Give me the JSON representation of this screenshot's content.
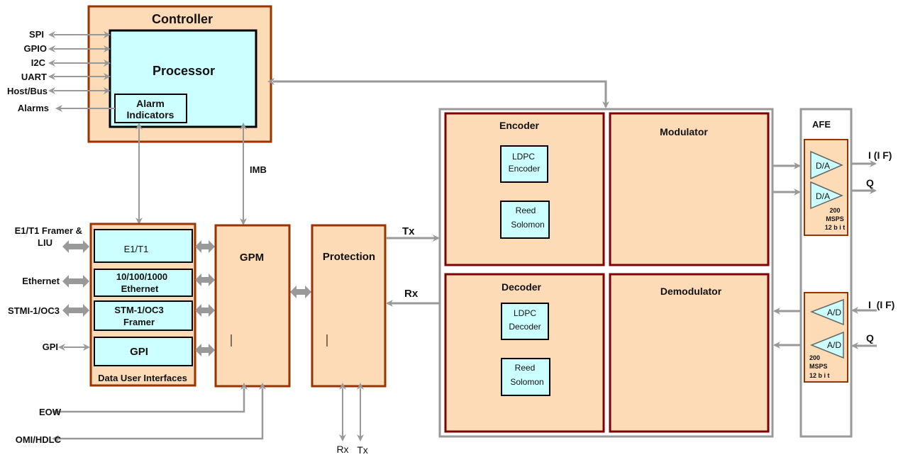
{
  "controller": {
    "title": "Controller",
    "processor": "Processor",
    "alarm_indicators": [
      "Alarm",
      "Indicators"
    ],
    "io_labels": [
      "SPI",
      "GPIO",
      "I2C",
      "UART",
      "Host/Bus",
      "Alarms"
    ]
  },
  "imb_label": "IMB",
  "data_user_interfaces": {
    "title": "Data User Interfaces",
    "blocks": [
      {
        "lines": [
          "E1/T1"
        ]
      },
      {
        "lines": [
          "10/100/1000",
          "Ethernet"
        ]
      },
      {
        "lines": [
          "STM-1/OC3",
          "Framer"
        ]
      },
      {
        "lines": [
          "GPI"
        ]
      }
    ],
    "external_labels": [
      {
        "lines": [
          "E1/T1 Framer &",
          "LIU"
        ]
      },
      {
        "lines": [
          "Ethernet"
        ]
      },
      {
        "lines": [
          "STMI-1/OC3"
        ]
      },
      {
        "lines": [
          "GPI"
        ]
      }
    ]
  },
  "gpm": {
    "title": "GPM"
  },
  "protection": {
    "title": "Protection",
    "tx": "Tx",
    "rx": "Rx"
  },
  "bottom_labels": {
    "eow": "EOW",
    "omi_hdlc": "OMI/HDLC",
    "rx": "Rx",
    "tx": "Tx"
  },
  "codec": {
    "encoder": {
      "title": "Encoder",
      "blocks": [
        [
          "LDPC",
          "Encoder"
        ],
        [
          "Reed",
          "Solomon"
        ]
      ]
    },
    "decoder": {
      "title": "Decoder",
      "blocks": [
        [
          "LDPC",
          "Decoder"
        ],
        [
          "Reed",
          "Solomon"
        ]
      ]
    },
    "modulator": {
      "title": "Modulator"
    },
    "demodulator": {
      "title": "Demodulator"
    }
  },
  "afe": {
    "title": "AFE",
    "dac": {
      "label": "D/A",
      "spec": [
        "200",
        "MSPS",
        "12 b i t"
      ]
    },
    "adc": {
      "label": "A/D",
      "spec": [
        "200",
        "MSPS",
        "12 b i t"
      ]
    },
    "outputs": [
      "I (I F)",
      "Q"
    ],
    "inputs": [
      "I  (I F)",
      "Q"
    ]
  }
}
